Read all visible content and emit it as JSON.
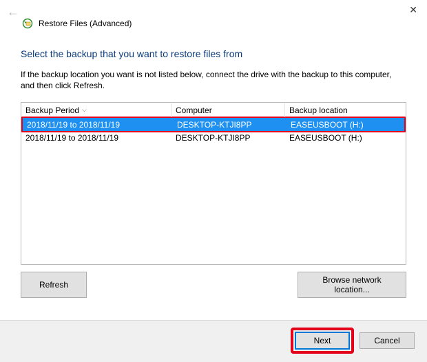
{
  "window": {
    "title": "Restore Files (Advanced)"
  },
  "heading": "Select the backup that you want to restore files from",
  "description": "If the backup location you want is not listed below, connect the drive with the backup to this computer, and then click Refresh.",
  "columns": {
    "period": "Backup Period",
    "computer": "Computer",
    "location": "Backup location"
  },
  "rows": [
    {
      "period": "2018/11/19 to 2018/11/19",
      "computer": "DESKTOP-KTJI8PP",
      "location": "EASEUSBOOT (H:)",
      "selected": true
    },
    {
      "period": "2018/11/19 to 2018/11/19",
      "computer": "DESKTOP-KTJI8PP",
      "location": "EASEUSBOOT (H:)",
      "selected": false
    }
  ],
  "buttons": {
    "refresh": "Refresh",
    "browse": "Browse network location...",
    "next": "Next",
    "cancel": "Cancel"
  }
}
